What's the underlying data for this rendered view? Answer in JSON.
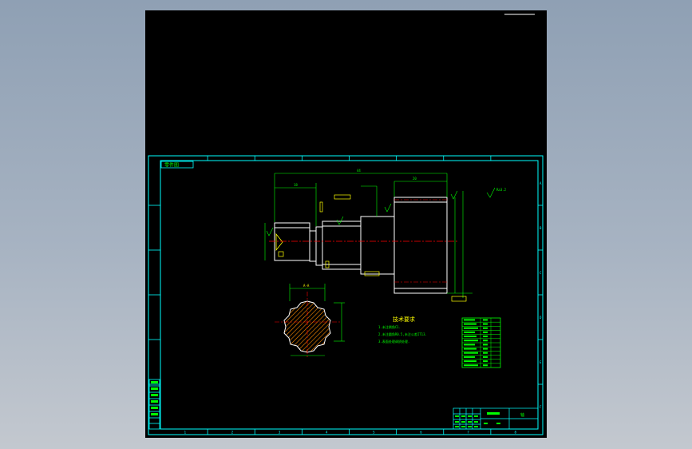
{
  "window": {
    "background_gradient": [
      "#8fa0b4",
      "#c3c8cf"
    ],
    "viewport_background": "#000000"
  },
  "colors": {
    "frame": "#00ffff",
    "outline": "#ffffff",
    "centerline": "#ff0000",
    "dimension": "#00ff00",
    "annotation": "#ffff00",
    "hatch": "#ff8c00"
  },
  "drawing": {
    "title_tag": "零件图",
    "tech_title": "技术要求",
    "tech_notes": [
      "1.未注倒角C1.",
      "2.未注圆角R0.5,未注公差IT13.",
      "3.表面处理调质处理."
    ],
    "title_block_name": "轴",
    "title_block_sub": "",
    "ref_section": "A-A",
    "roughness_general": "Ra3.2",
    "dims_top": [
      "—",
      "44",
      "18",
      "20"
    ],
    "border_numbers_bottom": [
      "1",
      "2",
      "3",
      "4",
      "5",
      "6",
      "7",
      "8"
    ],
    "border_letters_right": [
      "A",
      "B",
      "C",
      "D",
      "E",
      "F"
    ]
  }
}
